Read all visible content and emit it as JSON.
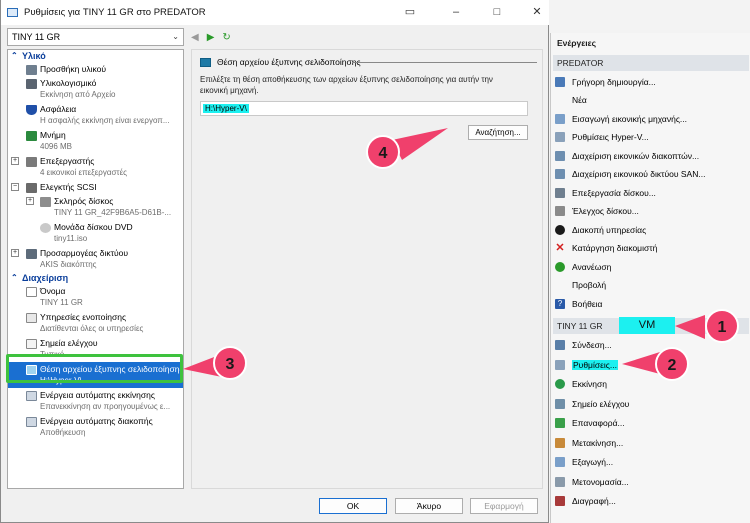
{
  "dialog": {
    "title": "Ρυθμίσεις για TINY 11 GR στο PREDATOR",
    "vm_selector": "TINY 11 GR",
    "buttons": {
      "ok": "OK",
      "cancel": "Άκυρο",
      "apply": "Εφαρμογή"
    }
  },
  "tree": {
    "hardware_header": "Υλικό",
    "management_header": "Διαχείριση",
    "hardware": [
      {
        "name": "Προσθήκη υλικού",
        "detail": ""
      },
      {
        "name": "Υλικολογισμικό",
        "detail": "Εκκίνηση από Αρχείο"
      },
      {
        "name": "Ασφάλεια",
        "detail": "Η ασφαλής εκκίνηση είναι ενεργοπ..."
      },
      {
        "name": "Μνήμη",
        "detail": "4096 MB"
      },
      {
        "name": "Επεξεργαστής",
        "detail": "4 εικονικοί επεξεργαστές"
      },
      {
        "name": "Ελεγκτής SCSI",
        "detail": ""
      },
      {
        "name": "Σκληρός δίσκος",
        "detail": "TINY 11 GR_42F9B6A5-D61B-..."
      },
      {
        "name": "Μονάδα δίσκου DVD",
        "detail": "tiny11.iso"
      },
      {
        "name": "Προσαρμογέας δικτύου",
        "detail": "AKIS διακόπτης"
      }
    ],
    "management": [
      {
        "name": "Όνομα",
        "detail": "TINY 11 GR"
      },
      {
        "name": "Υπηρεσίες ενοποίησης",
        "detail": "Διατίθενται όλες οι υπηρεσίες"
      },
      {
        "name": "Σημεία ελέγχου",
        "detail": "Τυπικό"
      },
      {
        "name": "Θέση αρχείου έξυπνης σελιδοποίησης",
        "detail": "H:\\Hyper-V\\"
      },
      {
        "name": "Ενέργεια αυτόματης εκκίνησης",
        "detail": "Επανεκκίνηση αν προηγουμένως ε..."
      },
      {
        "name": "Ενέργεια αυτόματης διακοπής",
        "detail": "Αποθήκευση"
      }
    ]
  },
  "panel": {
    "header": "Θέση αρχείου έξυπνης σελιδοποίησης",
    "description": "Επιλέξτε τη θέση αποθήκευσης των αρχείων έξυπνης σελιδοποίησης για αυτήν την εικονική μηχανή.",
    "path_value": "H:\\Hyper-V\\",
    "browse_label": "Αναζήτηση..."
  },
  "actions": {
    "title": "Ενέργειες",
    "host_section": "PREDATOR",
    "host_items": [
      "Γρήγορη δημιουργία...",
      "Νέα",
      "Εισαγωγή εικονικής μηχανής...",
      "Ρυθμίσεις Hyper-V...",
      "Διαχείριση εικονικών διακοπτών...",
      "Διαχείριση εικονικού δικτύου SAN...",
      "Επεξεργασία δίσκου...",
      "Έλεγχος δίσκου...",
      "Διακοπή υπηρεσίας",
      "Κατάργηση διακομιστή",
      "Ανανέωση",
      "Προβολή",
      "Βοήθεια"
    ],
    "vm_section": "TINY 11 GR",
    "vm_items": [
      "Σύνδεση...",
      "Ρυθμίσεις...",
      "Εκκίνηση",
      "Σημείο ελέγχου",
      "Επαναφορά...",
      "Μετακίνηση...",
      "Εξαγωγή...",
      "Μετονομασία...",
      "Διαγραφή..."
    ]
  },
  "annotations": {
    "vm_label": "VM",
    "callout_1": "1",
    "callout_2": "2",
    "callout_3": "3",
    "callout_4": "4",
    "callout_color": "#f0406c",
    "highlight_color": "#1cf0f0",
    "box_color": "#3ec23e"
  }
}
